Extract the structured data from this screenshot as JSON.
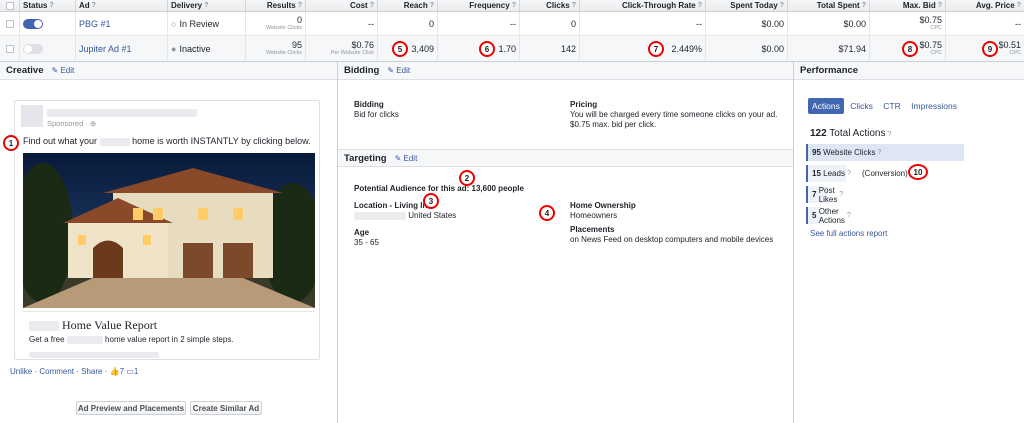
{
  "columns": {
    "status": "Status",
    "ad": "Ad",
    "delivery": "Delivery",
    "results": "Results",
    "cost": "Cost",
    "reach": "Reach",
    "frequency": "Frequency",
    "clicks": "Clicks",
    "ctr": "Click-Through Rate",
    "spent_today": "Spent Today",
    "total_spent": "Total Spent",
    "max_bid": "Max. Bid",
    "avg_price": "Avg. Price",
    "help": "?"
  },
  "rows": [
    {
      "ad": "PBG #1",
      "delivery": "In Review",
      "results": "0",
      "results_sub": "Website Clicks",
      "cost": "--",
      "cost_sub": "",
      "reach": "0",
      "frequency": "--",
      "clicks": "0",
      "ctr": "--",
      "spent_today": "$0.00",
      "total_spent": "$0.00",
      "max_bid": "$0.75",
      "max_bid_sub": "CPC",
      "avg_price": "--",
      "avg_price_sub": ""
    },
    {
      "ad": "Jupiter Ad #1",
      "delivery": "Inactive",
      "results": "95",
      "results_sub": "Website Clicks",
      "cost": "$0.76",
      "cost_sub": "Per Website Click",
      "reach": "3,409",
      "frequency": "1.70",
      "clicks": "142",
      "ctr": "2.449%",
      "spent_today": "$0.00",
      "total_spent": "$71.94",
      "max_bid": "$0.75",
      "max_bid_sub": "CPC",
      "avg_price": "$0.51",
      "avg_price_sub": "CPC"
    }
  ],
  "markers": [
    "1",
    "2",
    "3",
    "4",
    "5",
    "6",
    "7",
    "8",
    "9",
    "10"
  ],
  "creative": {
    "title": "Creative",
    "edit": "Edit",
    "sponsored": "Sponsored",
    "body_pre": "Find out what your",
    "body_post": "home is worth INSTANTLY by clicking below.",
    "headline": "Home Value Report",
    "desc_pre": "Get a free",
    "desc_post": "home value report in 2 simple steps.",
    "actions": "Unlike · Comment · Share ·",
    "likes": "7",
    "comments": "1",
    "preview_button": "Ad Preview and Placements",
    "similar_button": "Create Similar Ad"
  },
  "bidding": {
    "title": "Bidding",
    "edit": "Edit",
    "bidding_label": "Bidding",
    "bidding_value": "Bid for clicks",
    "pricing_label": "Pricing",
    "pricing_line1": "You will be charged every time someone clicks on your ad.",
    "pricing_line2": "$0.75 max. bid per click."
  },
  "targeting": {
    "title": "Targeting",
    "edit": "Edit",
    "audience": "Potential Audience for this ad: 13,600 people",
    "location_label": "Location - Living In:",
    "location_value": "United States",
    "age_label": "Age",
    "age_value": "35 - 65",
    "home_label": "Home Ownership",
    "home_value": "Homeowners",
    "placements_label": "Placements",
    "placements_value": "on News Feed on desktop computers and mobile devices"
  },
  "performance": {
    "title": "Performance",
    "tabs": [
      "Actions",
      "Clicks",
      "CTR",
      "Impressions"
    ],
    "total_num": "122",
    "total_label": "Total Actions",
    "items": [
      {
        "num": "95",
        "label": "Website Clicks"
      },
      {
        "num": "15",
        "label": "Leads"
      },
      {
        "num": "7",
        "label": "Post Likes"
      },
      {
        "num": "5",
        "label": "Other Actions"
      }
    ],
    "conversion": "(Conversion)",
    "report_link": "See full actions report"
  },
  "colors": {
    "accent": "#4267b2",
    "link": "#365899",
    "marker": "#ee0000",
    "review": "#42b72a"
  }
}
